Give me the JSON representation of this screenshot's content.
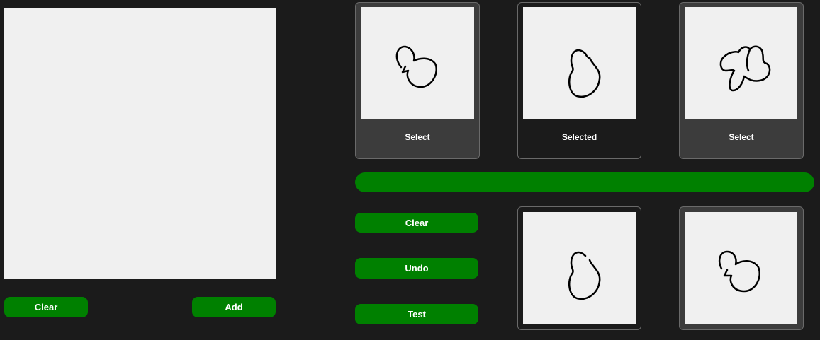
{
  "drawing_canvas": {},
  "left_buttons": {
    "clear_label": "Clear",
    "add_label": "Add"
  },
  "cards": [
    {
      "label": "Select",
      "state": "unselected",
      "sketch": "blob-notch"
    },
    {
      "label": "Selected",
      "state": "selected",
      "sketch": "droplet"
    },
    {
      "label": "Select",
      "state": "unselected",
      "sketch": "cloud"
    }
  ],
  "progress": {
    "value": 1.0,
    "color": "#008000"
  },
  "actions": {
    "clear_label": "Clear",
    "undo_label": "Undo",
    "test_label": "Test"
  },
  "results": [
    {
      "sketch": "droplet",
      "state": "selected"
    },
    {
      "sketch": "blob-notch",
      "state": "unselected"
    }
  ],
  "colors": {
    "accent": "#008000",
    "background": "#1b1b1b",
    "canvas": "#f0f0f0",
    "card_light": "#3c3c3c"
  }
}
